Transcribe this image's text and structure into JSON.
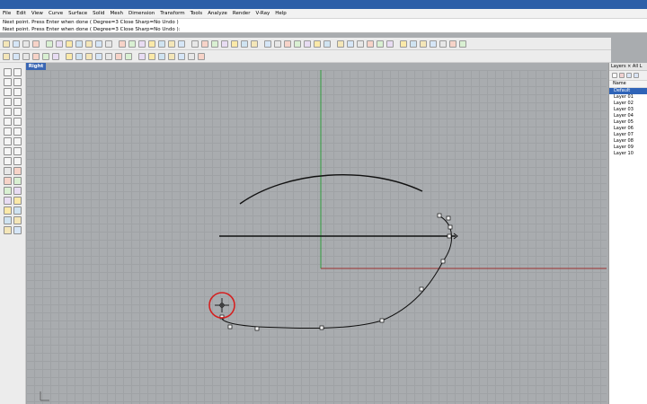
{
  "menu": [
    "File",
    "Edit",
    "View",
    "Curve",
    "Surface",
    "Solid",
    "Mesh",
    "Dimension",
    "Transform",
    "Tools",
    "Analyze",
    "Render",
    "V-Ray",
    "Help"
  ],
  "command": {
    "history": "Next point. Press Enter when done ( Degree=3  Close  Sharp=No  Undo )",
    "prompt": "Next point. Press Enter when done ( Degree=3  Close  Sharp=No  Undo ):"
  },
  "viewport": {
    "label": "Right"
  },
  "layers": {
    "title": "Layers × All L",
    "column_header": "Name",
    "items": [
      "Default",
      "Layer 01",
      "Layer 02",
      "Layer 03",
      "Layer 04",
      "Layer 05",
      "Layer 06",
      "Layer 07",
      "Layer 08",
      "Layer 09",
      "Layer 10"
    ],
    "selected": "Default"
  },
  "colors": {
    "x_axis": "#9c2f2f",
    "y_axis": "#2f9c3c",
    "cursor_circle": "#d42020",
    "selected_layer": "#2f64b8"
  }
}
